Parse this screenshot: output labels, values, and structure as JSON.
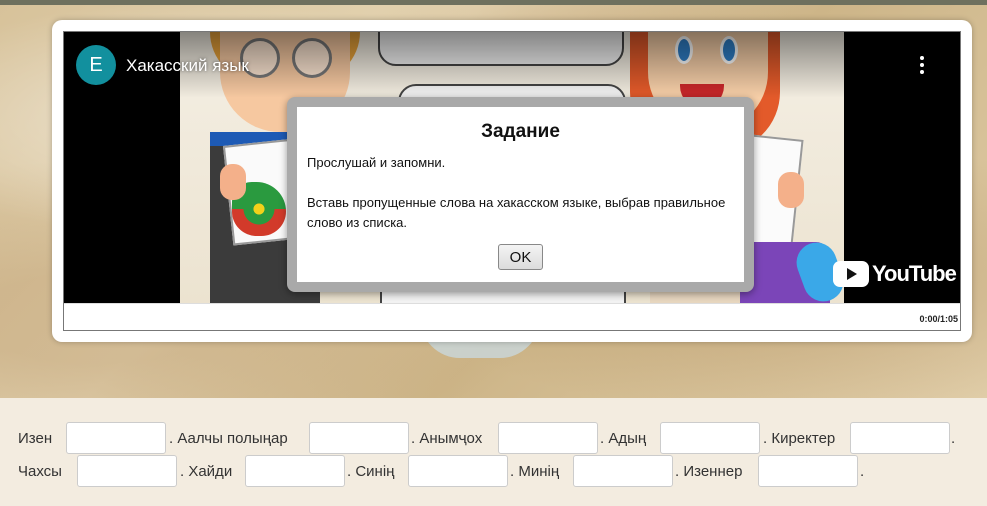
{
  "video": {
    "channel_initial": "E",
    "title": "Хакасский язык",
    "time": "0:00/1:05",
    "brand": "YouTube"
  },
  "dialog": {
    "title": "Задание",
    "line1": "Прослушай и запомни.",
    "line2": "Вставь пропущенные слова на хакасском языке, выбрав правильное слово из списка.",
    "ok_label": "OK"
  },
  "exercise": {
    "row1": [
      "Изен",
      ". Аалчы полыңар",
      ". Анымҷох",
      ". Адың",
      ". Киректер",
      "."
    ],
    "row2": [
      "Чахсы",
      ". Хайди",
      ". Синің",
      ". Минің",
      ". Изеннер",
      "."
    ]
  }
}
